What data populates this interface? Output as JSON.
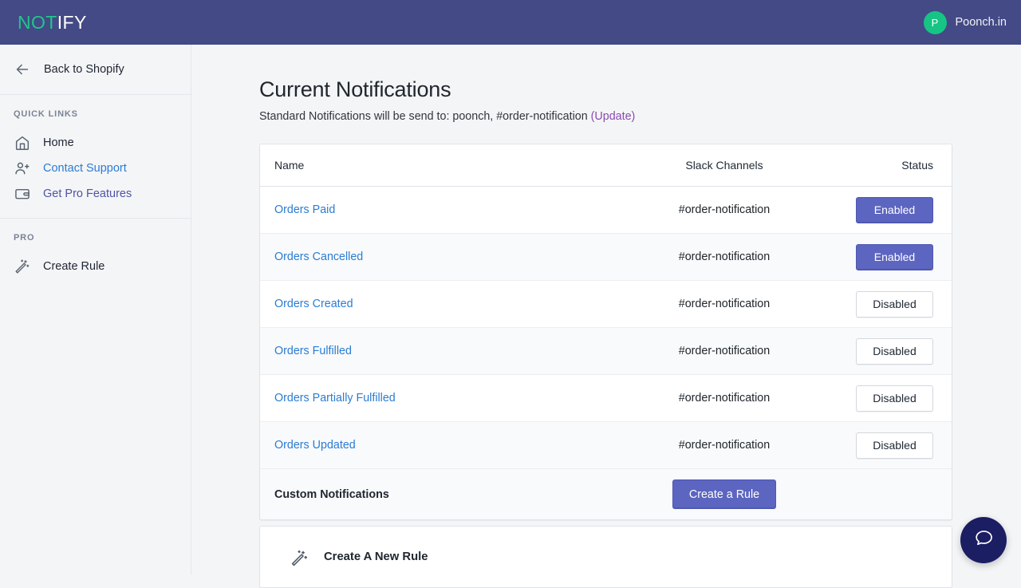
{
  "topbar": {
    "logo_part_a": "NOT",
    "logo_part_b": "IFY",
    "avatar_initial": "P",
    "user_name": "Poonch.in",
    "bg_color": "#434a85",
    "accent_green": "#16c485"
  },
  "sidebar": {
    "back_label": "Back to Shopify",
    "sections": [
      {
        "heading": "QUICK LINKS",
        "items": [
          {
            "label": "Home",
            "icon": "home-icon",
            "style": "lbl-dark"
          },
          {
            "label": "Contact Support",
            "icon": "contact-support-icon",
            "style": "lbl-blue"
          },
          {
            "label": "Get Pro Features",
            "icon": "wallet-icon",
            "style": "lbl-indigo"
          }
        ]
      },
      {
        "heading": "PRO",
        "items": [
          {
            "label": "Create Rule",
            "icon": "magic-wand-icon",
            "style": "lbl-dark"
          }
        ]
      }
    ]
  },
  "main": {
    "title": "Current Notifications",
    "subtitle_prefix": "Standard Notifications will be send to: poonch, #order-notification ",
    "update_link": "(Update)",
    "update_link_color": "#8a4ab0",
    "table": {
      "headers": {
        "name": "Name",
        "channels": "Slack Channels",
        "status": "Status"
      },
      "rows": [
        {
          "name": "Orders Paid",
          "channel": "#order-notification",
          "status": "Enabled",
          "enabled": true
        },
        {
          "name": "Orders Cancelled",
          "channel": "#order-notification",
          "status": "Enabled",
          "enabled": true
        },
        {
          "name": "Orders Created",
          "channel": "#order-notification",
          "status": "Disabled",
          "enabled": false
        },
        {
          "name": "Orders Fulfilled",
          "channel": "#order-notification",
          "status": "Disabled",
          "enabled": false
        },
        {
          "name": "Orders Partially Fulfilled",
          "channel": "#order-notification",
          "status": "Disabled",
          "enabled": false
        },
        {
          "name": "Orders Updated",
          "channel": "#order-notification",
          "status": "Disabled",
          "enabled": false
        }
      ]
    },
    "custom": {
      "label": "Custom Notifications",
      "button_label": "Create a Rule"
    },
    "new_rule": {
      "label": "Create A New Rule",
      "icon": "magic-wand-icon"
    }
  },
  "chat": {
    "icon": "chat-bubble-icon",
    "bg_color": "#1b1e63"
  }
}
